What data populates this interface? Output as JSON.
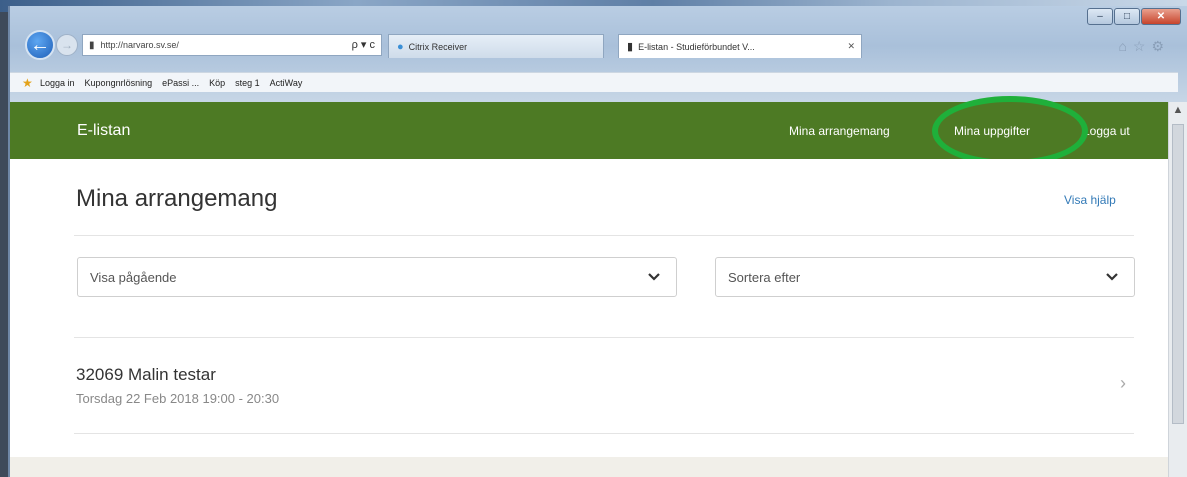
{
  "browser": {
    "address": "http://narvaro.sv.se/",
    "address_tools": "ρ ▾ с",
    "tabs": [
      {
        "label": "Citrix Receiver"
      },
      {
        "label": "E-listan - Studieförbundet V...",
        "close": "✕"
      }
    ],
    "favorites": [
      "Logga in",
      "Kupongnrlösning",
      "ePassi ...",
      "Köp",
      "steg 1",
      "ActiWay"
    ],
    "window_controls": {
      "min": "–",
      "max": "□",
      "close": "✕"
    }
  },
  "header": {
    "brand": "E-listan",
    "nav": [
      "Mina arrangemang",
      "Mina uppgifter",
      "Logga ut"
    ]
  },
  "main": {
    "title": "Mina arrangemang",
    "help": "Visa hjälp",
    "filter_select": "Visa pågående",
    "sort_select": "Sortera efter",
    "events": [
      {
        "title": "32069 Malin testar",
        "date": "Torsdag 22 Feb 2018 19:00 - 20:30",
        "arrow": "›"
      }
    ]
  },
  "annotation_color": "#1fb03a",
  "header_color": "#4d7a24"
}
